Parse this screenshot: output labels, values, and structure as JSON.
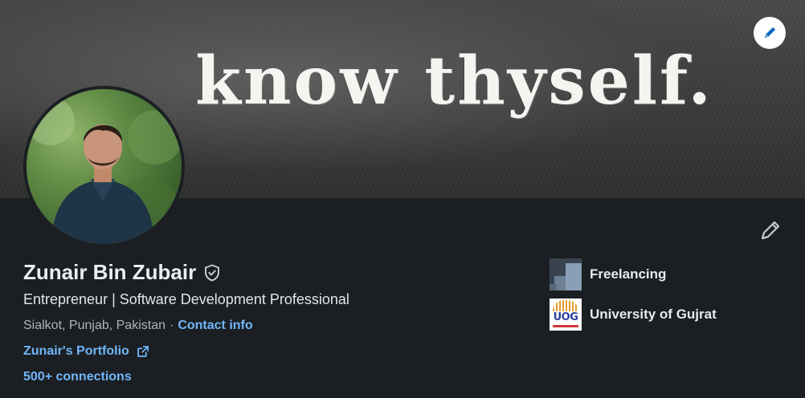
{
  "banner": {
    "text": "know thyself."
  },
  "profile": {
    "name": "Zunair Bin Zubair",
    "headline": "Entrepreneur | Software Development Professional",
    "location": "Sialkot, Punjab, Pakistan",
    "separator": "·",
    "contact_label": "Contact info",
    "portfolio_label": "Zunair's Portfolio",
    "connections_label": "500+ connections"
  },
  "side": {
    "items": [
      {
        "label": "Freelancing",
        "logo": "company-logo"
      },
      {
        "label": "University of Gujrat",
        "logo": "university-logo",
        "logo_text": "UOG"
      }
    ]
  },
  "icons": {
    "banner_edit": "pencil-icon",
    "profile_edit": "pencil-icon",
    "verification": "shield-check-icon",
    "external_link": "external-link-icon"
  },
  "colors": {
    "background": "#1b1f23",
    "link": "#71b7fb",
    "edit_icon_blue": "#0a66c2",
    "primary_text": "#e8e9eb",
    "secondary_text": "#b0b3b8"
  }
}
